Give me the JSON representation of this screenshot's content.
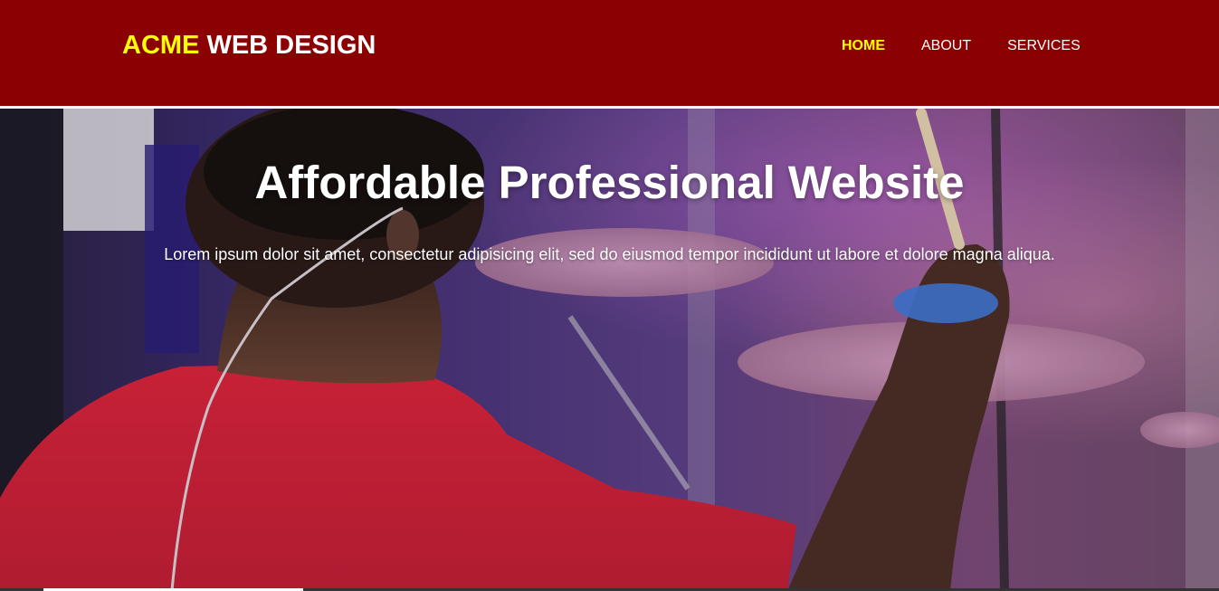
{
  "header": {
    "branding_highlight": "ACME",
    "branding_rest": " WEB DESIGN",
    "nav": [
      {
        "label": "HOME",
        "current": true
      },
      {
        "label": "ABOUT",
        "current": false
      },
      {
        "label": "SERVICES",
        "current": false
      }
    ]
  },
  "showcase": {
    "title": "Affordable Professional Website",
    "text": "Lorem ipsum dolor sit amet, consectetur adipisicing elit, sed do eiusmod tempor incididunt ut labore et dolore magna aliqua.",
    "image": "drummer-photo"
  },
  "colors": {
    "header_bg": "#8b0000",
    "accent": "#ffff00",
    "text": "#ffffff"
  }
}
